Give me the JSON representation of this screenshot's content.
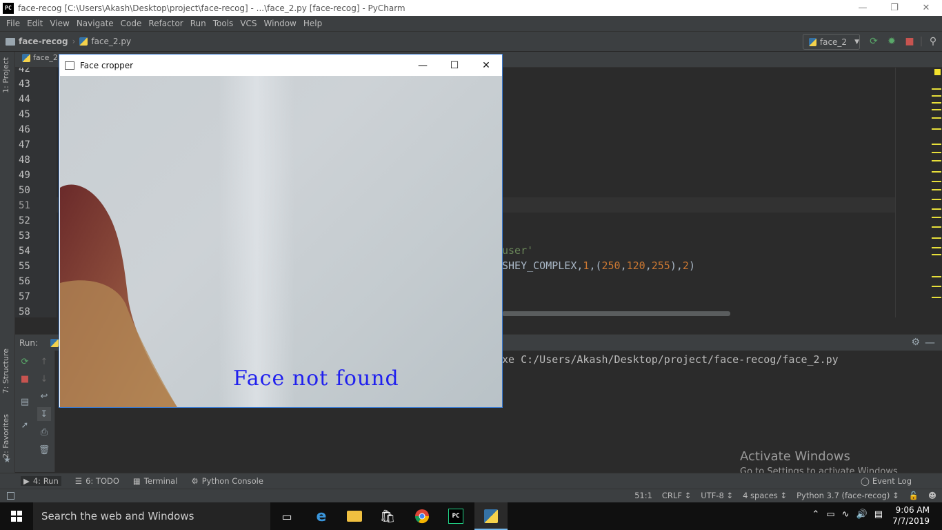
{
  "titlebar": {
    "logo": "PC",
    "title": "face-recog [C:\\Users\\Akash\\Desktop\\project\\face-recog] - ...\\face_2.py [face-recog] - PyCharm"
  },
  "menu": [
    "File",
    "Edit",
    "View",
    "Navigate",
    "Code",
    "Refactor",
    "Run",
    "Tools",
    "VCS",
    "Window",
    "Help"
  ],
  "breadcrumb": {
    "project": "face-recog",
    "file": "face_2.py"
  },
  "run_config": {
    "name": "face_2"
  },
  "editor": {
    "tab": "face_2.",
    "line_numbers": [
      "42",
      "43",
      "44",
      "45",
      "46",
      "47",
      "48",
      "49",
      "50",
      "51",
      "52",
      "53",
      "54",
      "55",
      "56",
      "57",
      "58"
    ],
    "fragment_54": "user'",
    "fragment_55_prefix": "SHEY_COMPLEX,",
    "fragment_55_n1": "1",
    "fragment_55_c1": "250",
    "fragment_55_c2": "120",
    "fragment_55_c3": "255",
    "fragment_55_n2": "2"
  },
  "left_stripe": {
    "project": "1: Project",
    "structure": "7: Structure",
    "favorites": "2: Favorites"
  },
  "run_panel": {
    "label": "Run:",
    "console_text": "xe C:/Users/Akash/Desktop/project/face-recog/face_2.py"
  },
  "bottom_tabs": [
    {
      "label": "4: Run",
      "active": true
    },
    {
      "label": "6: TODO",
      "active": false
    },
    {
      "label": "Terminal",
      "active": false
    },
    {
      "label": "Python Console",
      "active": false
    }
  ],
  "event_log": "Event Log",
  "status": {
    "position": "51:1",
    "line_sep": "CRLF ↕",
    "encoding": "UTF-8 ↕",
    "indent": "4 spaces ↕",
    "interpreter": "Python 3.7 (face-recog) ↕"
  },
  "watermark": {
    "line1": "Activate Windows",
    "line2": "Go to Settings to activate Windows."
  },
  "face_window": {
    "title": "Face cropper",
    "overlay_text": "Face not found"
  },
  "taskbar": {
    "search_placeholder": "Search the web and Windows",
    "time": "9:06 AM",
    "date": "7/7/2019"
  },
  "colors": {
    "accent": "#3a7ad1",
    "overlay_text": "#2020ee",
    "string_token": "#6a8759",
    "number_token": "#cc7832"
  }
}
